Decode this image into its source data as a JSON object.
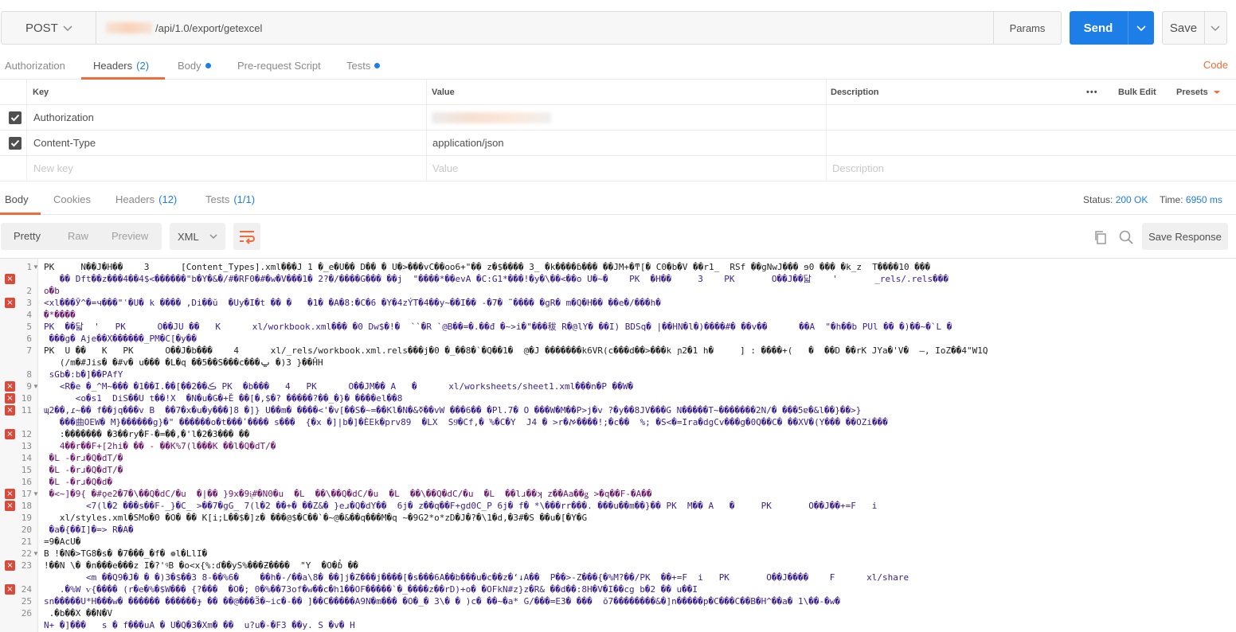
{
  "request": {
    "method": "POST",
    "url_path": "/api/1.0/export/getexcel",
    "params_label": "Params",
    "send_label": "Send",
    "save_label": "Save"
  },
  "request_tabs": {
    "authorization": "Authorization",
    "headers": "Headers",
    "headers_count": "(2)",
    "body": "Body",
    "prerequest": "Pre-request Script",
    "tests": "Tests",
    "code": "Code"
  },
  "headers_table": {
    "col_key": "Key",
    "col_value": "Value",
    "col_description": "Description",
    "bulk_edit": "Bulk Edit",
    "presets": "Presets",
    "rows": [
      {
        "key": "Authorization",
        "value": ""
      },
      {
        "key": "Content-Type",
        "value": "application/json"
      }
    ],
    "new_key_placeholder": "New key",
    "value_placeholder": "Value",
    "description_placeholder": "Description"
  },
  "response_tabs": {
    "body": "Body",
    "cookies": "Cookies",
    "headers": "Headers",
    "headers_count": "(12)",
    "tests": "Tests",
    "tests_count": "(1/1)",
    "status_label": "Status:",
    "status_value": "200 OK",
    "time_label": "Time:",
    "time_value": "6950 ms"
  },
  "response_toolbar": {
    "pretty": "Pretty",
    "raw": "Raw",
    "preview": "Preview",
    "format": "XML",
    "save_response": "Save Response"
  },
  "colors": {
    "accent": "#f26b3a",
    "send_blue": "#1c7ee6",
    "error_red": "#d84a3a"
  },
  "body_lines": [
    "PK     N��J�H��    3      [Content_Types].xml���J 1 �_e�U�� D�� � U�>���vC��oo6+\"�� z�$���� 3_ �k����ɓ��� ��JM+�ͳ[� C0�b�V ��r1_  RSf ��gNwJ��� ɘ0 ��� �k_z  T����10 ���",
    "   �� Dft��z���4��4$<������\"b�Y�&�/#�RF0�#�w�V���1� 2?�/����G��� ��j  \"����*��evA �C:G1*���!�y�\\��<��o U�~�    PK  �H��     3    PK       O��J��닯    '       _rels/.rels���",
    "o�b",
    "<xl���Ӯ^�=ч���\"ʿ�U� k ���� ,Di��ŭ  �Uy�I�t �� �   �1� �A�8:�C�6 �Y�4zÝT�4��y~��I�� -�7� ˜���� �gR� m�Q�H�� ��e�/���h�",
    "�*����",
    "PK  ��닯  '   PK      O��JU ��   K      xl/workbook.xml��� �0 Dw$�!�  ``�R `@B��=�.��đ �~>i�\"���秡 R�@lY� ��I) BDSq� |��HN�l�)����#� ��v��      ��A  \"�h��b PUl �� �)��~�`L �",
    " ���g� Aje��X������_PM�C[�y��",
    "PK  U ��   K   PK      O��J�b���    4      xl/_rels/workbook.xml.rels���j�0 �_��8�`�Q��1�  @�J �������k6VR(c���d��>���k ɲ2�1 h�     ] : ����+(   �  ��D ��rK JYa�'V�  —, IoZ��4\"W1Q",
    "   (/m�#Jis� �#v� u��� �L�q ��5��S���c���ݐ �)3 }��ĤH",
    " sGb�:b�]��PAfY",
    "   <R�e �_^M~��� �1��I.��[��2��ڪ PK  �b���   4   PK      O��JM�� A   �      xl/worksheets/sheet1.xml���n�P ��W�",
    "      <o�s1  DiS��U t��!X  �N�u�G�+Ȅ ��[�,$�? �����?��_�}� ����el��8",
    "ɰ2��,ɾ~�� f��jq���v B  ��7�x�u�y���]8 �]} U��m� ����<'�v[��S�~=��Kl�N�&ߧ��vW ���6�� �Pl.7� O ���W�M��P>j�v ?�y��8JV���G N�����T~�������2N/� ���5ɐ�&l��}��>}",
    "   ���曲OEW� M}������g}�\" ������o�t���ʹ���� s���  {�x �]|b�]�ÈEk�prv89  �LX  S9ͪ�Cf,� ֹ%�C�Y  J4 � >r�ࠀ����!;�c��  %; �S<�=Ira�dgCv���g�0Q��C� ��XV�(Y��� ��OZi���",
    "   :������� �3��ry�F-�=��,�'l�2�3��� ��",
    "   4��r��F+[2hi� �� - ��K%7(l���K ��l�Q�dT/�",
    " �L -�rɹ�Q�dT/�",
    " �L -�rɹ�Q�dT/�",
    " �L -�rɹ�Q�d�",
    " �<~]�9{ �#ǫe2�7�\\��Q�dC/�u  �|�� }9x�9ᶖ#�N0�u  �L  ��\\��Q�dC/�u  �L  ��\\��Q�dC/�u  �L  ��lɹ��ʞ z��Aa��ǥ >�q��F-�A��",
    "        <7(l�2 ���s��F-_}�C_ >��7�gG_ 7(l�2 ��+� ��Z&� }eɹ�Q�dY��  6j� z��q��F+gd0C_P 6j� f� *\\���rr���. ���u��m��}�� PK  M�� A   �     PK       O��J��+=F   i",
    "   xl/styles.xml�SMo�0 �O� �� K[i;L��$�]z� ���@$�C��`�~@�&��q���M�q ~�9G2*o*zD�J�?�\\1�d,�3#�S ��u�[�Y�G",
    " �a�{��I]�=> R�A�",
    "=9�AcU�",
    "B !�N�>TG8�s� �7���_�f� ❁l�LlI�",
    "!��N \\� �n���e���z I�?'ꝰB �o<x{%:ɗ��yS%���Ƶ����  \"Y  �O�ɓ̔ ��",
    "        <m ��Q9�J� � �)3�$��3 8-��%6�    ��h�-/��a\\8� ��]j�Z���j����[�s���6A��b���u�c��z�ʻ↓A��  P��>-Z���{�%M?��/PK  ��+=F  i   PK       O��J����    F      xl/share",
    "   .�%W ѵ{���� (r�e�%�$W��� {?���  �O�; 0�%��73of�w��c�h1��OF�����`�_����z��rD)+o� �OFkN#z}z�R& ��d��:8H�V�I��cg b�2 �� u��I",
    "sn�����U*H���w� ������ ������ɟ �� ��@���Ӟ�~ic�-�� ]��C�����A9N�m��� �O�_� 3\\� � )c� ��~�a* G/���=E3� ���  ŏ7��������&�]n�����p�C���C��B�H^��a� 1\\��-�w�",
    " .�b��X ��N�V",
    "N+ �]���   s � f���uA � U�Q�3�Xm� ��  u?u�-�F3 ��y. S �v� H"
  ]
}
